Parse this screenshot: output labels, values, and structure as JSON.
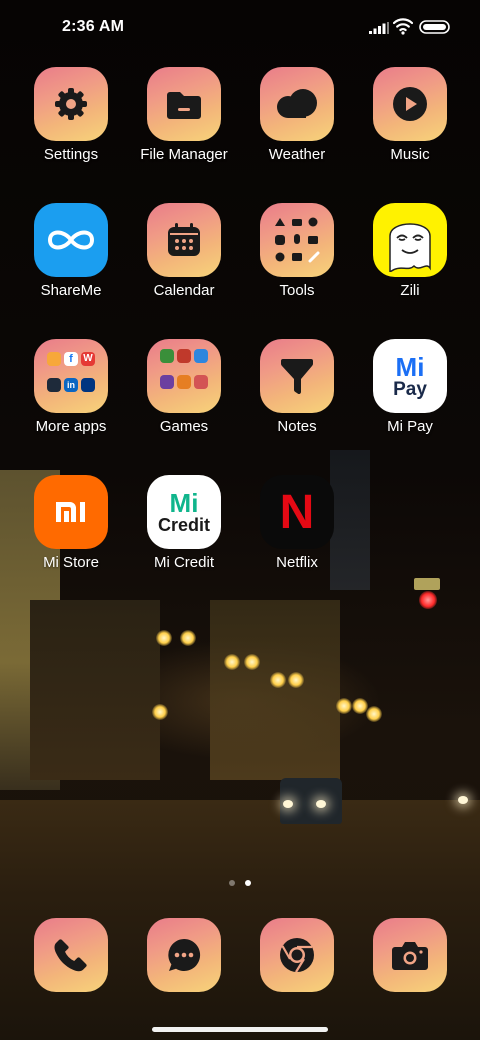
{
  "status_bar": {
    "time": "2:36 AM",
    "icons": [
      "signal-icon",
      "wifi-icon",
      "battery-icon"
    ]
  },
  "apps": {
    "settings": {
      "label": "Settings",
      "icon": "gear-icon"
    },
    "file_manager": {
      "label": "File Manager",
      "icon": "folder-icon"
    },
    "weather": {
      "label": "Weather",
      "icon": "cloud-icon"
    },
    "music": {
      "label": "Music",
      "icon": "play-icon"
    },
    "shareme": {
      "label": "ShareMe",
      "icon": "infinity-icon"
    },
    "calendar": {
      "label": "Calendar",
      "icon": "calendar-icon"
    },
    "tools": {
      "label": "Tools",
      "icon": "tools-grid-icon"
    },
    "zili": {
      "label": "Zili",
      "icon": "zili-face-icon"
    },
    "more_apps": {
      "label": "More apps",
      "icon": "folder-icon",
      "mini_labels": [
        "W",
        "f",
        "in"
      ]
    },
    "games": {
      "label": "Games",
      "icon": "folder-icon"
    },
    "notes": {
      "label": "Notes",
      "icon": "notes-icon"
    },
    "mi_pay": {
      "label": "Mi Pay",
      "icon": "mi-pay-icon",
      "line1": "Mi",
      "line2": "Pay"
    },
    "mi_store": {
      "label": "Mi Store",
      "icon": "mi-logo-icon"
    },
    "mi_credit": {
      "label": "Mi Credit",
      "icon": "mi-credit-icon",
      "line1": "Mi",
      "line2": "Credit"
    },
    "netflix": {
      "label": "Netflix",
      "icon": "netflix-icon",
      "letter": "N"
    }
  },
  "dock": [
    {
      "name": "phone",
      "icon": "phone-icon"
    },
    {
      "name": "messaging",
      "icon": "chat-icon"
    },
    {
      "name": "chrome",
      "icon": "chrome-icon"
    },
    {
      "name": "camera",
      "icon": "camera-icon"
    }
  ],
  "pages": {
    "count": 2,
    "current": 2
  },
  "colors": {
    "theme_start": "#e97c8a",
    "theme_end": "#f7d37a",
    "shareme_blue": "#1b9ef0",
    "zili_yellow": "#fff200",
    "mi_orange": "#ff6a00",
    "mi_credit_green": "#10b58c",
    "netflix_red": "#e50914"
  }
}
